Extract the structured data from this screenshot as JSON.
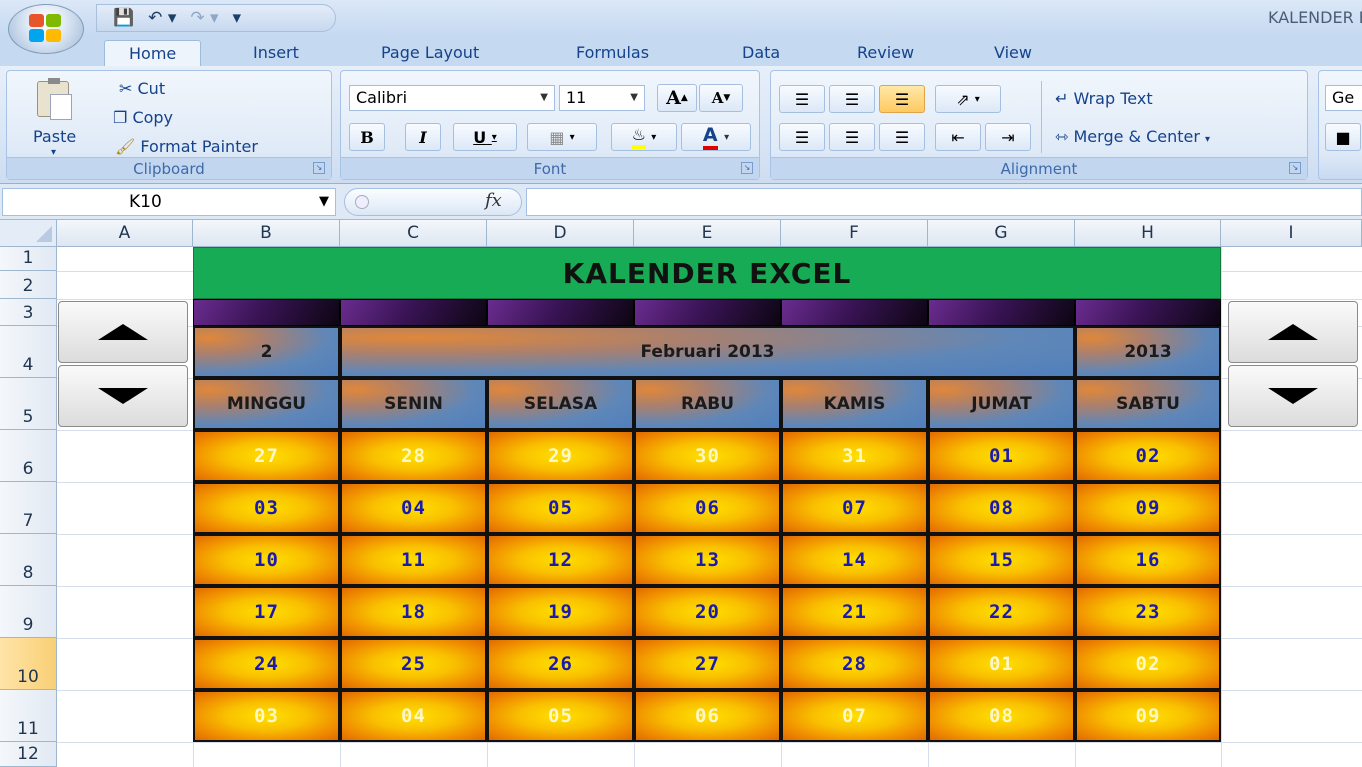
{
  "window": {
    "title": "KALENDER EXCEL"
  },
  "tabs": [
    "Home",
    "Insert",
    "Page Layout",
    "Formulas",
    "Data",
    "Review",
    "View"
  ],
  "clipboard": {
    "paste": "Paste",
    "cut": "Cut",
    "copy": "Copy",
    "format_painter": "Format Painter",
    "label": "Clipboard"
  },
  "font": {
    "name": "Calibri",
    "size": "11",
    "label": "Font",
    "bold": "B",
    "italic": "I",
    "underline": "U",
    "grow": "A",
    "shrink": "A",
    "color": "A"
  },
  "alignment": {
    "wrap_text": "Wrap Text",
    "merge_center": "Merge & Center",
    "label": "Alignment"
  },
  "next_group_partial": "Ge",
  "formula_bar": {
    "name_box": "K10",
    "fx": "fx",
    "value": ""
  },
  "columns": [
    "A",
    "B",
    "C",
    "D",
    "E",
    "F",
    "G",
    "H",
    "I"
  ],
  "rows": [
    "1",
    "2",
    "3",
    "4",
    "5",
    "6",
    "7",
    "8",
    "9",
    "10",
    "11",
    "12"
  ],
  "selected_row": "10",
  "calendar": {
    "title": "KALENDER EXCEL",
    "month_number": "2",
    "month_label": "Februari 2013",
    "year": "2013",
    "weekdays": [
      "MINGGU",
      "SENIN",
      "SELASA",
      "RABU",
      "KAMIS",
      "JUMAT",
      "SABTU"
    ],
    "weeks": [
      [
        {
          "d": "27",
          "cur": false
        },
        {
          "d": "28",
          "cur": false
        },
        {
          "d": "29",
          "cur": false
        },
        {
          "d": "30",
          "cur": false
        },
        {
          "d": "31",
          "cur": false
        },
        {
          "d": "01",
          "cur": true
        },
        {
          "d": "02",
          "cur": true
        }
      ],
      [
        {
          "d": "03",
          "cur": true
        },
        {
          "d": "04",
          "cur": true
        },
        {
          "d": "05",
          "cur": true
        },
        {
          "d": "06",
          "cur": true
        },
        {
          "d": "07",
          "cur": true
        },
        {
          "d": "08",
          "cur": true
        },
        {
          "d": "09",
          "cur": true
        }
      ],
      [
        {
          "d": "10",
          "cur": true
        },
        {
          "d": "11",
          "cur": true
        },
        {
          "d": "12",
          "cur": true
        },
        {
          "d": "13",
          "cur": true
        },
        {
          "d": "14",
          "cur": true
        },
        {
          "d": "15",
          "cur": true
        },
        {
          "d": "16",
          "cur": true
        }
      ],
      [
        {
          "d": "17",
          "cur": true
        },
        {
          "d": "18",
          "cur": true
        },
        {
          "d": "19",
          "cur": true
        },
        {
          "d": "20",
          "cur": true
        },
        {
          "d": "21",
          "cur": true
        },
        {
          "d": "22",
          "cur": true
        },
        {
          "d": "23",
          "cur": true
        }
      ],
      [
        {
          "d": "24",
          "cur": true
        },
        {
          "d": "25",
          "cur": true
        },
        {
          "d": "26",
          "cur": true
        },
        {
          "d": "27",
          "cur": true
        },
        {
          "d": "28",
          "cur": true
        },
        {
          "d": "01",
          "cur": false
        },
        {
          "d": "02",
          "cur": false
        }
      ],
      [
        {
          "d": "03",
          "cur": false
        },
        {
          "d": "04",
          "cur": false
        },
        {
          "d": "05",
          "cur": false
        },
        {
          "d": "06",
          "cur": false
        },
        {
          "d": "07",
          "cur": false
        },
        {
          "d": "08",
          "cur": false
        },
        {
          "d": "09",
          "cur": false
        }
      ]
    ]
  },
  "colors": {
    "title_green": "#17ab55",
    "current_day_text": "#1a1ab0",
    "other_day_text": "#fff7c8"
  }
}
